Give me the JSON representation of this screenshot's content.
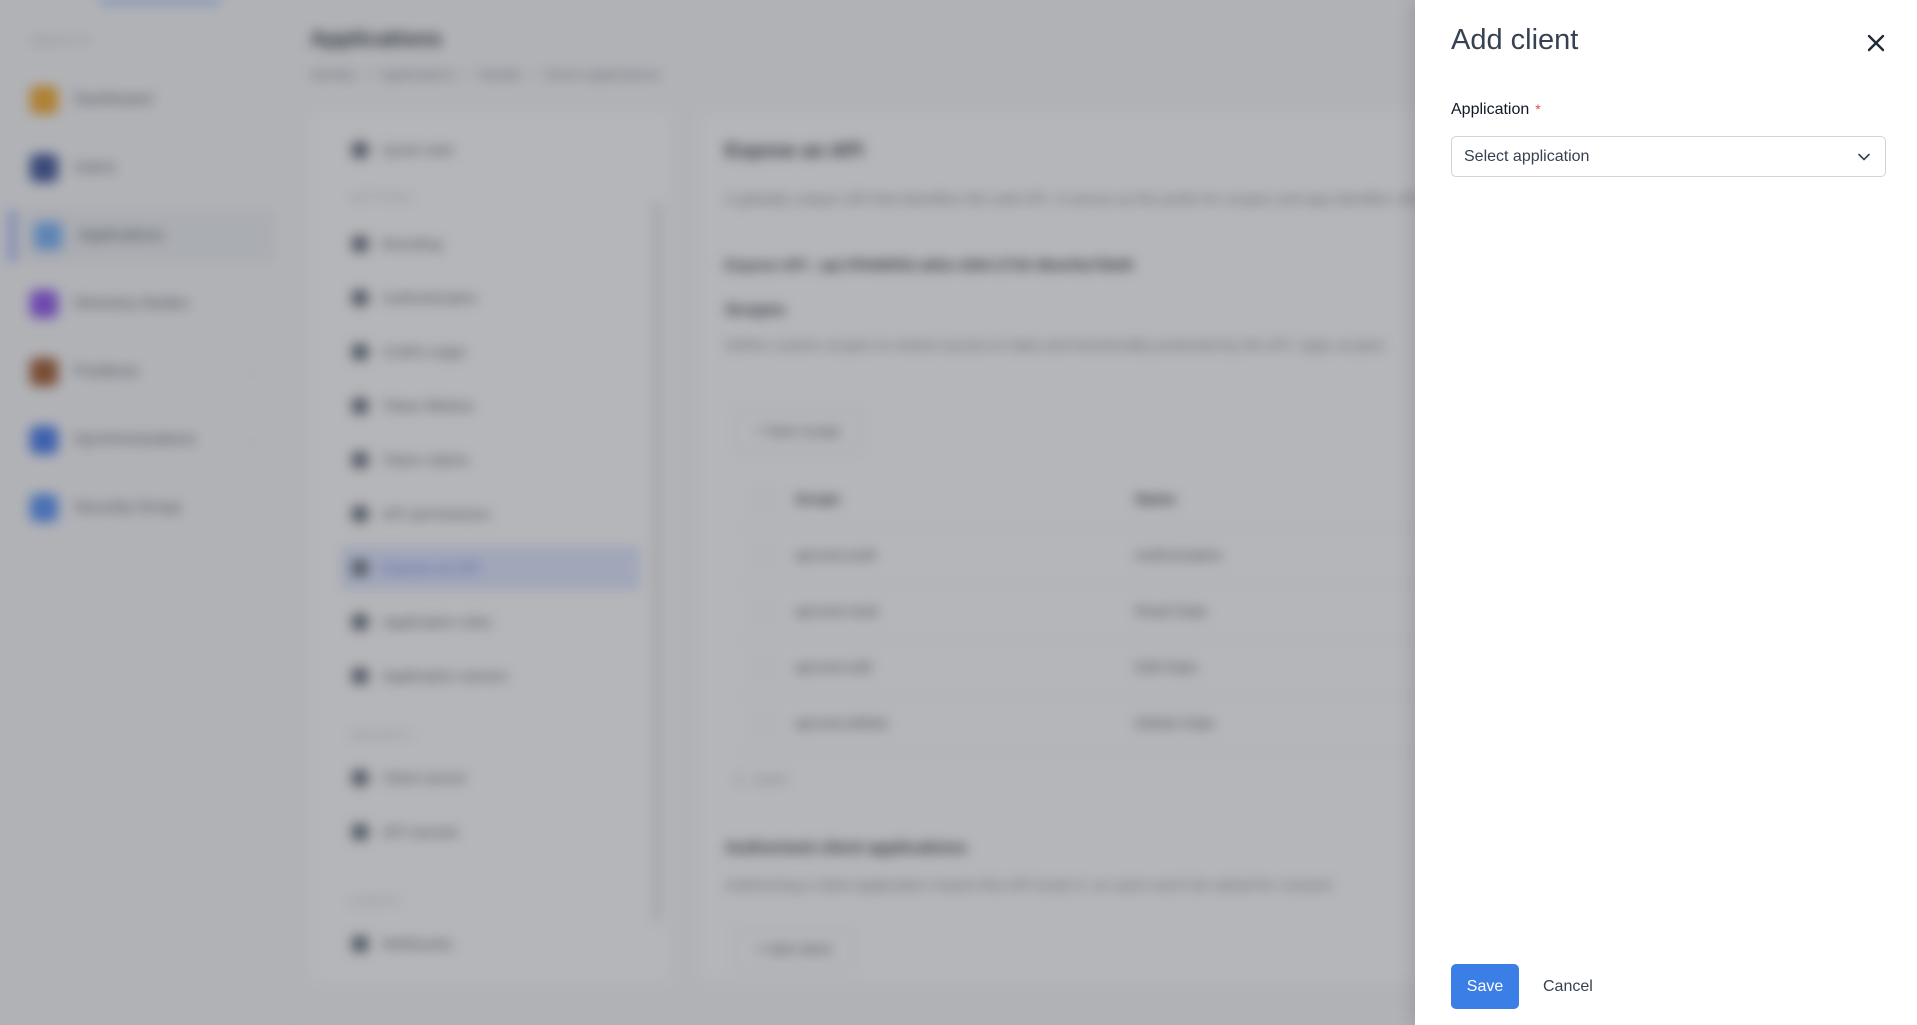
{
  "background": {
    "nav": {
      "section": "IDENTITY",
      "items": [
        {
          "label": "Dashboard",
          "color": "#f59e0b"
        },
        {
          "label": "Users",
          "color": "#1e3a8a"
        },
        {
          "label": "Applications",
          "color": "#60a5fa"
        },
        {
          "label": "Directory Nodes",
          "color": "#7c3aed"
        },
        {
          "label": "Positions",
          "color": "#92400e"
        },
        {
          "label": "Synchronizations",
          "color": "#2563eb"
        },
        {
          "label": "Security Group",
          "color": "#3b82f6"
        }
      ]
    },
    "page_title": "Applications",
    "breadcrumb": [
      "Identity",
      "/",
      "Applications",
      "/",
      "Details",
      "/",
      "Demo applications"
    ],
    "sub_nav": {
      "quick_start": "Quick start",
      "section_settings": "SETTINGS",
      "items": [
        "Branding",
        "Authentication",
        "CORS origin",
        "Token lifetime",
        "Token claims",
        "API permissions",
        "Expose an API",
        "Application roles",
        "Application owners"
      ],
      "section_security": "SECURITY",
      "security_items": [
        "Client secret",
        "API secrets"
      ],
      "section_events": "EVENTS",
      "event_items": [
        "Webhooks"
      ]
    },
    "content": {
      "heading": "Expose an API",
      "description": "A globally unique URI that identifies this web API. It serves as the prefix for scopes and app identifier URI.",
      "expose_line": "Expose API : api://f4495f42-a83e-4364-2730-38eef4a75b08",
      "scopes_heading": "Scopes",
      "scopes_description": "Define custom scopes to restrict access to data and functionality protected by the API. Apps scopes.",
      "new_scope_button": "+ New scope",
      "table_headers": [
        "Scope",
        "Name"
      ],
      "rows": [
        {
          "scope": "api.test.auth",
          "name": "Authorization"
        },
        {
          "scope": "api.test.read",
          "name": "Read Data"
        },
        {
          "scope": "api.test.edit",
          "name": "Edit Data"
        },
        {
          "scope": "api.test.delete",
          "name": "Delete Data"
        }
      ],
      "pager": "1 - 4 of 4",
      "authorized_heading": "Authorized client applications",
      "authorized_description": "Authorizing a client application means this API trusts it, so users won't be asked for consent.",
      "add_client_button": "+ Add client"
    }
  },
  "drawer": {
    "title": "Add client",
    "field_label": "Application",
    "required_mark": "*",
    "select_placeholder": "Select application",
    "save_label": "Save",
    "cancel_label": "Cancel"
  },
  "colors": {
    "primary": "#3b7fe6",
    "required": "#e5484d"
  }
}
